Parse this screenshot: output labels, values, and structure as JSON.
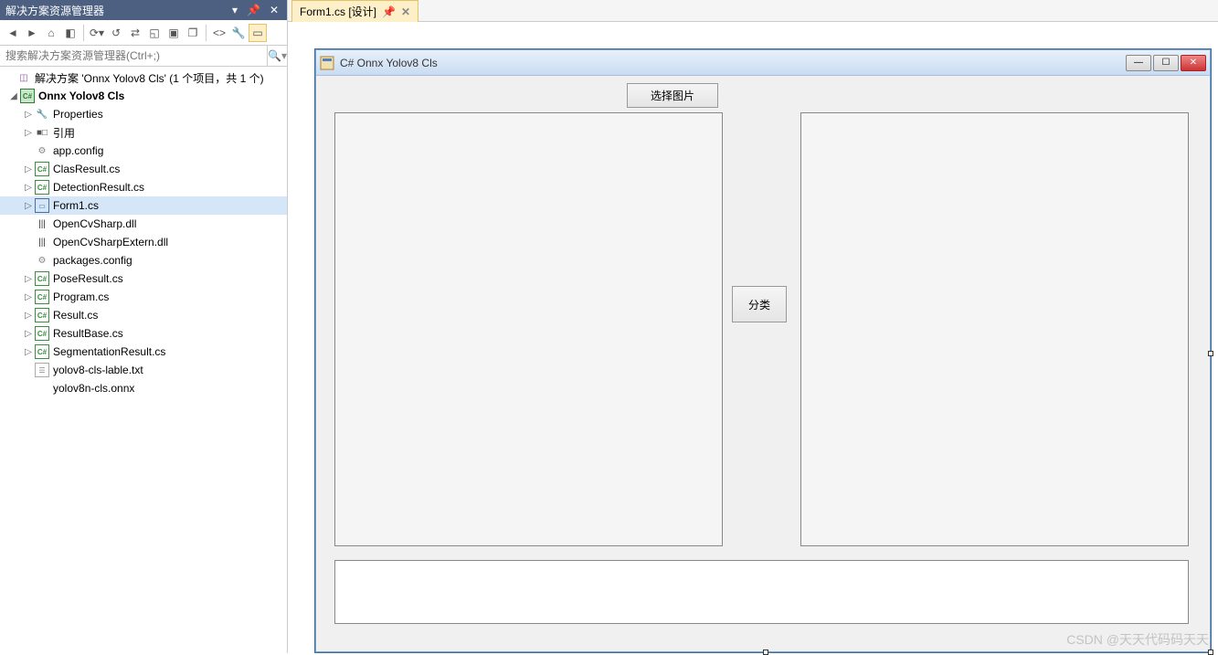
{
  "panel": {
    "title": "解决方案资源管理器",
    "search_placeholder": "搜索解决方案资源管理器(Ctrl+;)"
  },
  "tree": {
    "solution": "解决方案 'Onnx Yolov8 Cls' (1 个项目，共 1 个)",
    "project": "Onnx Yolov8 Cls",
    "items": [
      {
        "icon": "wrench",
        "label": "Properties",
        "exp": true
      },
      {
        "icon": "ref",
        "label": "引用",
        "exp": true
      },
      {
        "icon": "cfg",
        "label": "app.config",
        "exp": false
      },
      {
        "icon": "cs",
        "label": "ClasResult.cs",
        "exp": true
      },
      {
        "icon": "cs",
        "label": "DetectionResult.cs",
        "exp": true
      },
      {
        "icon": "form",
        "label": "Form1.cs",
        "exp": true,
        "selected": true
      },
      {
        "icon": "dll",
        "label": "OpenCvSharp.dll",
        "exp": false
      },
      {
        "icon": "dll",
        "label": "OpenCvSharpExtern.dll",
        "exp": false
      },
      {
        "icon": "cfg",
        "label": "packages.config",
        "exp": false
      },
      {
        "icon": "cs",
        "label": "PoseResult.cs",
        "exp": true
      },
      {
        "icon": "cs",
        "label": "Program.cs",
        "exp": true
      },
      {
        "icon": "cs",
        "label": "Result.cs",
        "exp": true
      },
      {
        "icon": "cs",
        "label": "ResultBase.cs",
        "exp": true
      },
      {
        "icon": "cs",
        "label": "SegmentationResult.cs",
        "exp": true
      },
      {
        "icon": "txt",
        "label": "yolov8-cls-lable.txt",
        "exp": false
      },
      {
        "icon": "none",
        "label": "yolov8n-cls.onnx",
        "exp": false
      }
    ]
  },
  "tab": {
    "label": "Form1.cs [设计]"
  },
  "form": {
    "title": "C# Onnx Yolov8 Cls",
    "btn_select": "选择图片",
    "btn_classify": "分类"
  },
  "watermark": "CSDN @天天代码码天天"
}
